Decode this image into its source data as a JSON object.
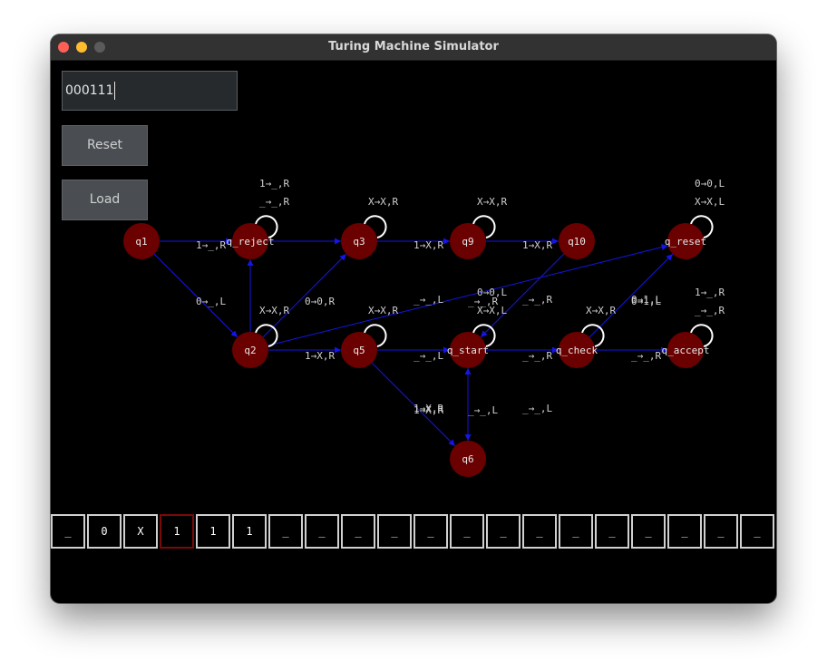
{
  "window": {
    "title": "Turing Machine Simulator"
  },
  "input": {
    "value": "000111"
  },
  "buttons": {
    "reset": "Reset",
    "load": "Load"
  },
  "tape": {
    "cells": [
      "_",
      "0",
      "X",
      "1",
      "1",
      "1",
      "_",
      "_",
      "_",
      "_",
      "_",
      "_",
      "_",
      "_",
      "_",
      "_",
      "_",
      "_",
      "_",
      "_"
    ],
    "head_index": 3
  },
  "colors": {
    "state_fill": "#6b0000",
    "edge": "#1515e6",
    "label": "#d0d0d0"
  },
  "states": [
    {
      "id": "q1",
      "label": "q1"
    },
    {
      "id": "q_reject",
      "label": "q_reject"
    },
    {
      "id": "q3",
      "label": "q3"
    },
    {
      "id": "q9",
      "label": "q9"
    },
    {
      "id": "q10",
      "label": "q10"
    },
    {
      "id": "q_reset",
      "label": "q_reset"
    },
    {
      "id": "q2",
      "label": "q2"
    },
    {
      "id": "q5",
      "label": "q5"
    },
    {
      "id": "q_start",
      "label": "q_start"
    },
    {
      "id": "q_check",
      "label": "q_check"
    },
    {
      "id": "q_accept",
      "label": "q_accept"
    },
    {
      "id": "q6",
      "label": "q6"
    }
  ],
  "transitions": [
    {
      "from": "q1",
      "to": "q_reject",
      "label": "1→_,R"
    },
    {
      "from": "q1",
      "to": "q2",
      "label": "0→_,L"
    },
    {
      "from": "q_reject",
      "to": "q3"
    },
    {
      "from": "q3",
      "to": "q9",
      "label": "1→X,R"
    },
    {
      "from": "q9",
      "to": "q10",
      "label": "1→X,R"
    },
    {
      "from": "q2",
      "to": "q_reject"
    },
    {
      "from": "q2",
      "to": "q3",
      "label": "0→0,R"
    },
    {
      "from": "q2",
      "to": "q5",
      "label": "1→X,R"
    },
    {
      "from": "q2",
      "to": "q_reset",
      "label": "0→0,L"
    },
    {
      "from": "q10",
      "to": "q_start",
      "label": "_→_,R"
    },
    {
      "from": "q5",
      "to": "q_start",
      "label": "_→_,L"
    },
    {
      "from": "q5",
      "to": "q6",
      "label": "1→X,R"
    },
    {
      "from": "q6",
      "to": "q_start",
      "label": "_→_,L"
    },
    {
      "from": "q_start",
      "to": "q6"
    },
    {
      "from": "q_start",
      "to": "q_check",
      "label": "_→_,R"
    },
    {
      "from": "q_check",
      "to": "q_accept",
      "label": "_→_,R"
    },
    {
      "from": "q_check",
      "to": "q_reset",
      "label": "0→1,L"
    }
  ],
  "loops": [
    {
      "state": "q_reject",
      "labels": [
        "1→_,R",
        "_→_,R"
      ]
    },
    {
      "state": "q3",
      "labels": [
        "X→X,R"
      ]
    },
    {
      "state": "q9",
      "labels": [
        "X→X,R"
      ]
    },
    {
      "state": "q_reset",
      "labels": [
        "0→0,L",
        "X→X,L"
      ]
    },
    {
      "state": "q2",
      "labels": [
        "X→X,R"
      ]
    },
    {
      "state": "q5",
      "labels": [
        "X→X,R"
      ]
    },
    {
      "state": "q_start",
      "labels": [
        "X→X,L"
      ]
    },
    {
      "state": "q_check",
      "labels": [
        "X→X,R"
      ]
    },
    {
      "state": "q_accept",
      "labels": [
        "1→_,R",
        "_→_,R"
      ]
    }
  ],
  "extra_labels": [
    "_→_,L",
    "_→_,R",
    "_→_,L",
    "1→X,R",
    "0→1,L"
  ]
}
